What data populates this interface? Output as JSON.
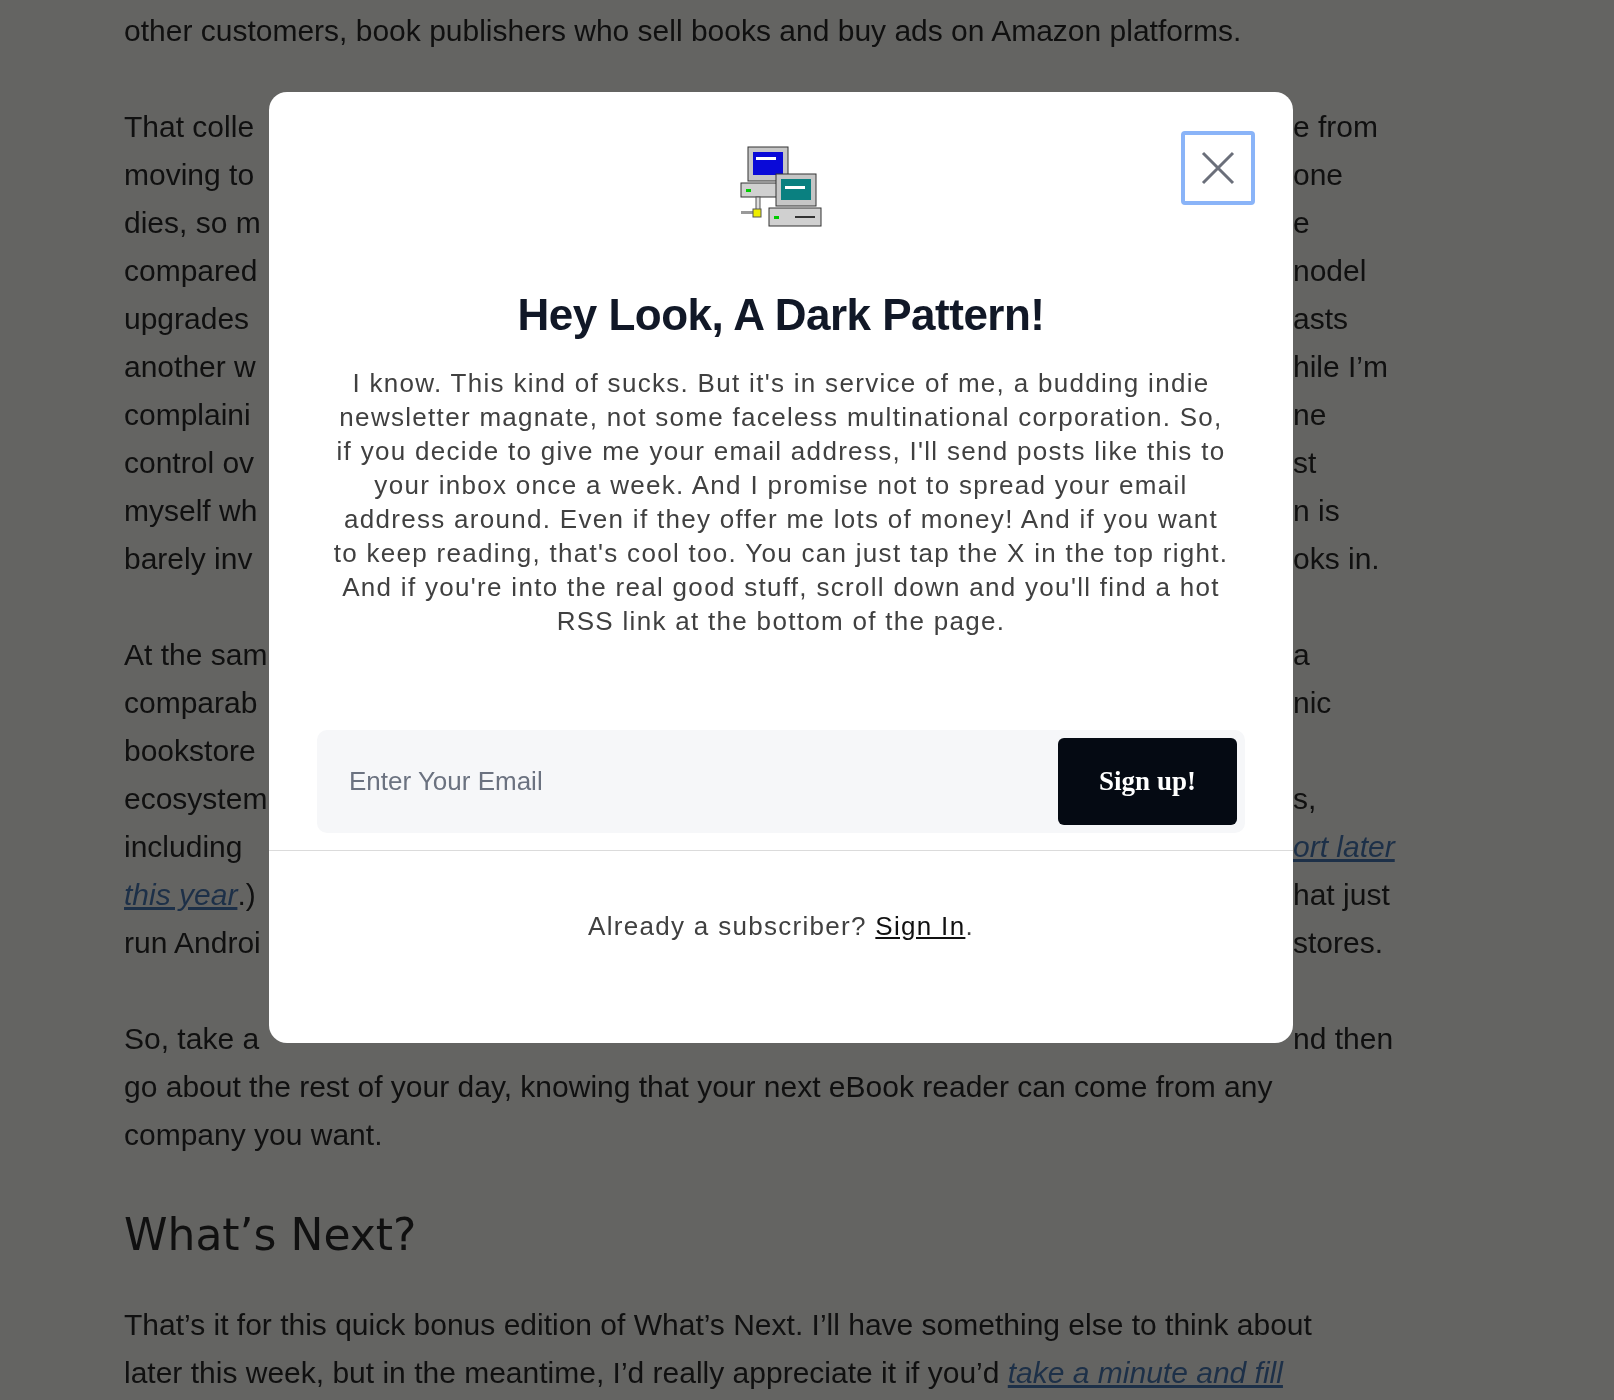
{
  "article": {
    "blocks": [
      {
        "kind": "paragraph",
        "lines": [
          {
            "left": [
              {
                "kind": "text",
                "text": "other customers, book publishers who sell books and buy ads on Amazon platforms."
              }
            ]
          }
        ]
      },
      {
        "kind": "paragraph",
        "lines": [
          {
            "left": [
              {
                "kind": "text",
                "text": "That colle"
              }
            ],
            "right": [
              {
                "kind": "text",
                "text": "e from"
              }
            ]
          },
          {
            "left": [
              {
                "kind": "text",
                "text": "moving to"
              }
            ],
            "right": [
              {
                "kind": "text",
                "text": "one"
              }
            ]
          },
          {
            "left": [
              {
                "kind": "text",
                "text": "dies, so m"
              }
            ],
            "right": [
              {
                "kind": "text",
                "text": "e"
              }
            ]
          },
          {
            "left": [
              {
                "kind": "text",
                "text": "compared"
              }
            ],
            "right": [
              {
                "kind": "text",
                "text": "nodel"
              }
            ]
          },
          {
            "left": [
              {
                "kind": "text",
                "text": "upgrades"
              }
            ],
            "right": [
              {
                "kind": "text",
                "text": "asts"
              }
            ]
          },
          {
            "left": [
              {
                "kind": "text",
                "text": "another w"
              }
            ],
            "right": [
              {
                "kind": "text",
                "text": "hile I’m"
              }
            ]
          },
          {
            "left": [
              {
                "kind": "text",
                "text": "complaini"
              }
            ],
            "right": [
              {
                "kind": "text",
                "text": "ne"
              }
            ]
          },
          {
            "left": [
              {
                "kind": "text",
                "text": "control ov"
              }
            ],
            "right": [
              {
                "kind": "text",
                "text": "st"
              }
            ]
          },
          {
            "left": [
              {
                "kind": "text",
                "text": "myself wh"
              }
            ],
            "right": [
              {
                "kind": "text",
                "text": "n is"
              }
            ]
          },
          {
            "left": [
              {
                "kind": "text",
                "text": "barely inv"
              }
            ],
            "right": [
              {
                "kind": "text",
                "text": "oks in."
              }
            ]
          }
        ]
      },
      {
        "kind": "paragraph",
        "lines": [
          {
            "left": [
              {
                "kind": "text",
                "text": "At the sam"
              }
            ],
            "right": [
              {
                "kind": "text",
                "text": "a"
              }
            ]
          },
          {
            "left": [
              {
                "kind": "text",
                "text": "comparab"
              }
            ],
            "right": [
              {
                "kind": "text",
                "text": "nic"
              }
            ]
          },
          {
            "left": [
              {
                "kind": "text",
                "text": "bookstore"
              }
            ]
          },
          {
            "left": [
              {
                "kind": "text",
                "text": "ecosystem"
              }
            ],
            "right": [
              {
                "kind": "text",
                "text": "s,"
              }
            ]
          },
          {
            "left": [
              {
                "kind": "text",
                "text": "including"
              }
            ],
            "right": [
              {
                "kind": "link",
                "text": "ort later"
              }
            ]
          },
          {
            "left": [
              {
                "kind": "link",
                "text": "this year"
              },
              {
                "kind": "text",
                "text": ".)"
              }
            ],
            "right": [
              {
                "kind": "text",
                "text": "hat just"
              }
            ]
          },
          {
            "left": [
              {
                "kind": "text",
                "text": "run Androi"
              }
            ],
            "right": [
              {
                "kind": "text",
                "text": "stores."
              }
            ]
          }
        ]
      },
      {
        "kind": "paragraph",
        "lines": [
          {
            "left": [
              {
                "kind": "text",
                "text": "So, take a"
              }
            ],
            "right": [
              {
                "kind": "text",
                "text": "nd then"
              }
            ]
          },
          {
            "left": [
              {
                "kind": "text",
                "text": "go about the rest of your day, knowing that your next eBook reader can come from any"
              }
            ]
          },
          {
            "left": [
              {
                "kind": "text",
                "text": "company you want."
              }
            ]
          }
        ]
      },
      {
        "kind": "heading",
        "lines": [
          {
            "left": [
              {
                "kind": "text",
                "text": "What’s Next?"
              }
            ]
          }
        ]
      },
      {
        "kind": "paragraph",
        "lines": [
          {
            "left": [
              {
                "kind": "text",
                "text": "That’s it for this quick bonus edition of What’s Next. I’ll have something else to think about"
              }
            ]
          },
          {
            "left": [
              {
                "kind": "text",
                "text": "later this week, but in the meantime, I’d really appreciate it if you’d "
              },
              {
                "kind": "link",
                "text": "take a minute and fill"
              }
            ]
          }
        ]
      }
    ]
  },
  "modal": {
    "close_button": {
      "focused": true
    },
    "title": "Hey Look, A Dark Pattern!",
    "body": "I know. This kind of sucks. But it's in service of me, a budding indie newsletter magnate, not some faceless multinational corporation. So, if you decide to give me your email address, I'll send posts like this to your inbox once a week. And I promise not to spread your email address around. Even if they offer me lots of money! And if you want to keep reading, that's cool too. You can just tap the X in the top right. And if you're into the real good stuff, scroll down and you'll find a hot RSS link at the bottom of the page.",
    "email": {
      "placeholder": "Enter Your Email"
    },
    "button": "Sign up!",
    "footer": {
      "prompt": "Already a subscriber? ",
      "link": "Sign In",
      "end": "."
    }
  }
}
